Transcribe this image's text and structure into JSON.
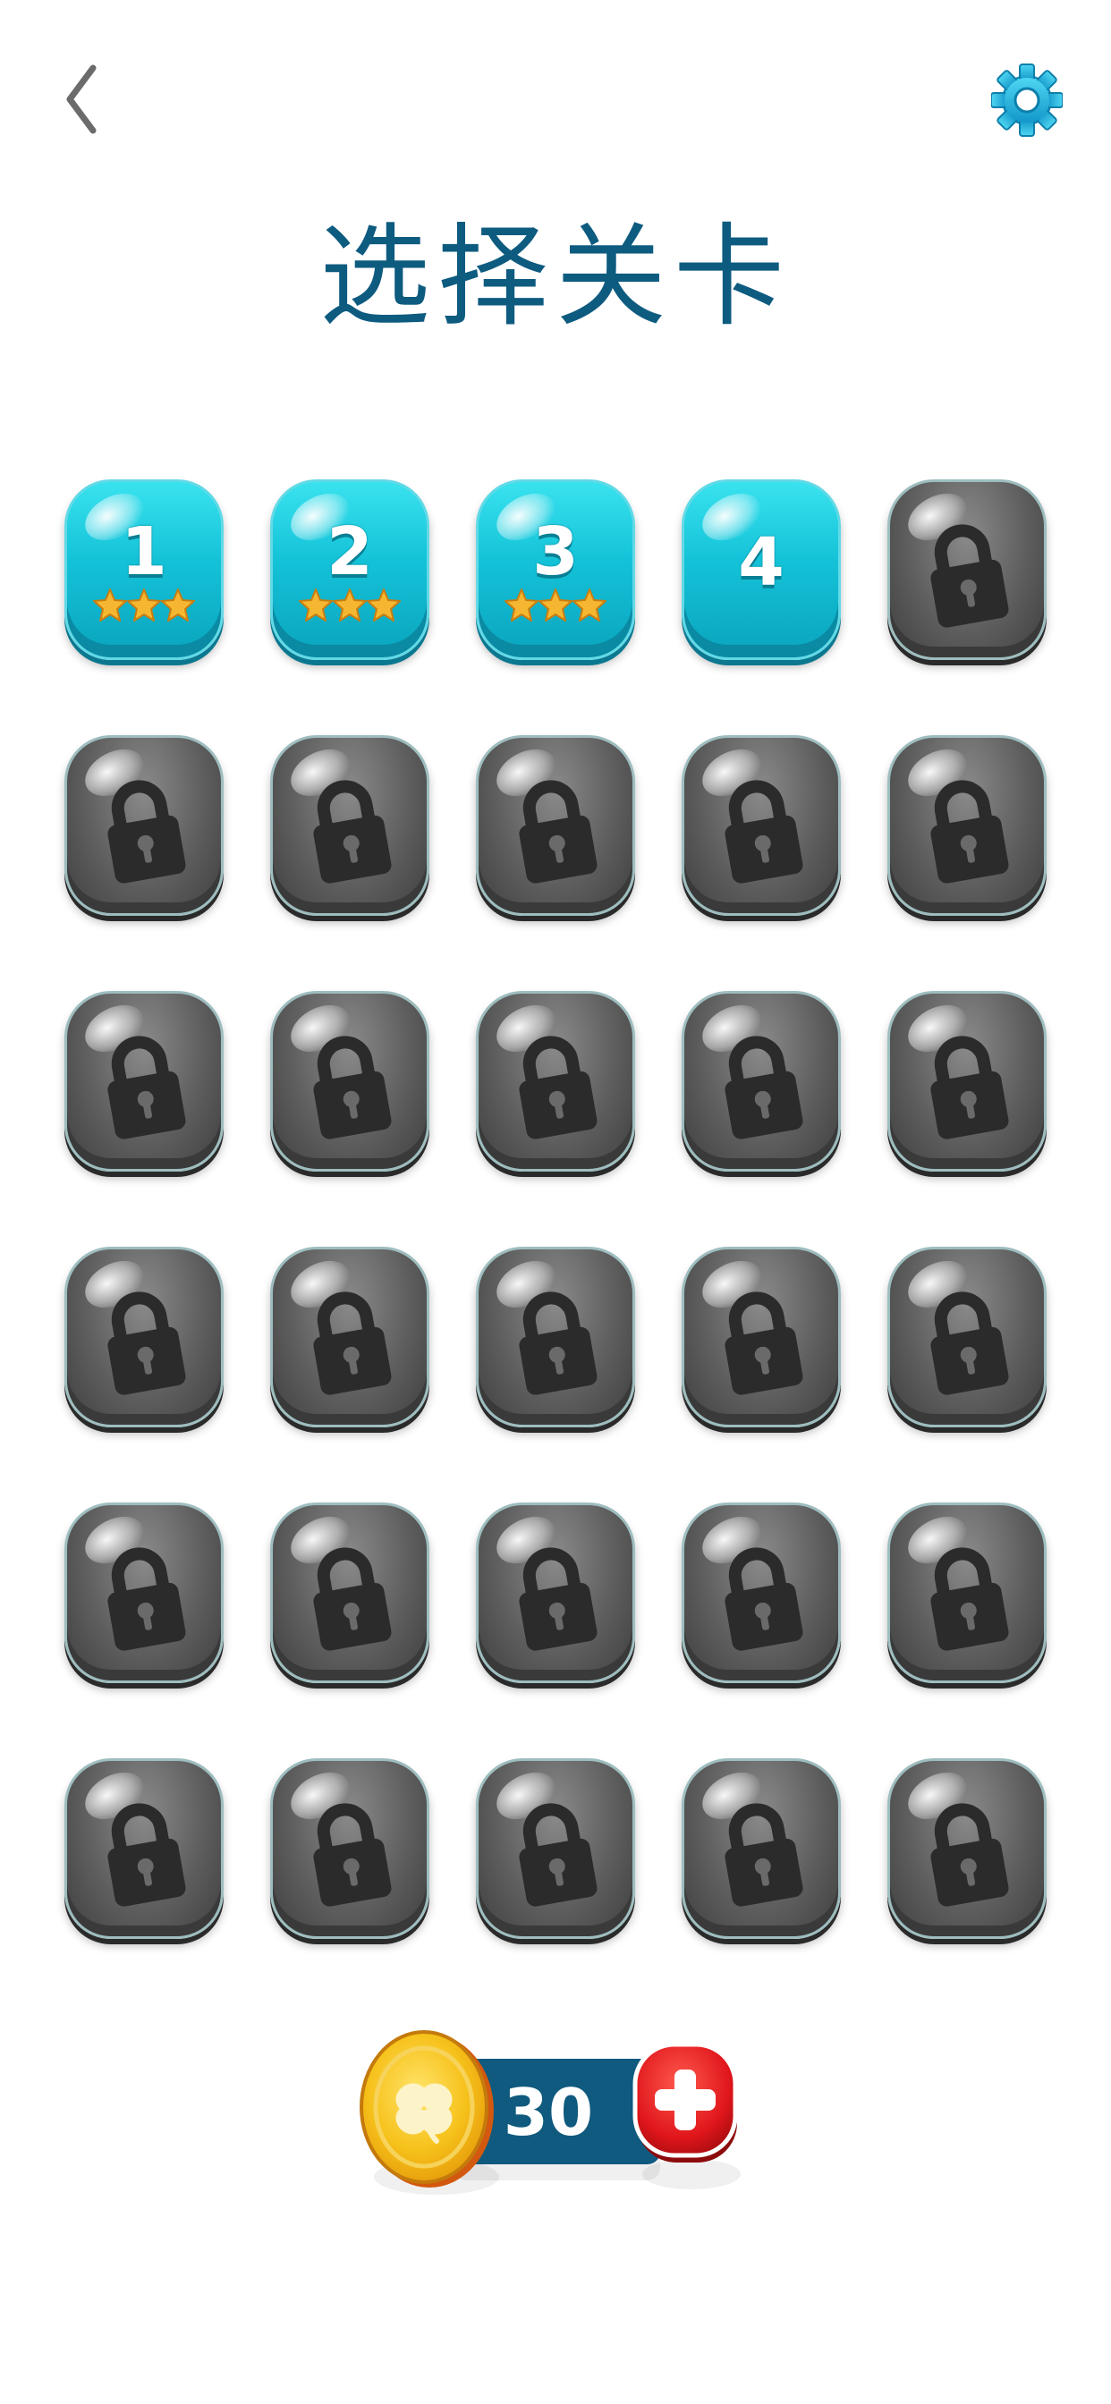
{
  "header": {
    "title": "选择关卡",
    "back_icon": "chevron-left-icon",
    "settings_icon": "gear-icon"
  },
  "levels": [
    {
      "label": "1",
      "locked": false,
      "stars": 3
    },
    {
      "label": "2",
      "locked": false,
      "stars": 3
    },
    {
      "label": "3",
      "locked": false,
      "stars": 3
    },
    {
      "label": "4",
      "locked": false,
      "stars": 0
    },
    {
      "label": "",
      "locked": true,
      "stars": 0
    },
    {
      "label": "",
      "locked": true,
      "stars": 0
    },
    {
      "label": "",
      "locked": true,
      "stars": 0
    },
    {
      "label": "",
      "locked": true,
      "stars": 0
    },
    {
      "label": "",
      "locked": true,
      "stars": 0
    },
    {
      "label": "",
      "locked": true,
      "stars": 0
    },
    {
      "label": "",
      "locked": true,
      "stars": 0
    },
    {
      "label": "",
      "locked": true,
      "stars": 0
    },
    {
      "label": "",
      "locked": true,
      "stars": 0
    },
    {
      "label": "",
      "locked": true,
      "stars": 0
    },
    {
      "label": "",
      "locked": true,
      "stars": 0
    },
    {
      "label": "",
      "locked": true,
      "stars": 0
    },
    {
      "label": "",
      "locked": true,
      "stars": 0
    },
    {
      "label": "",
      "locked": true,
      "stars": 0
    },
    {
      "label": "",
      "locked": true,
      "stars": 0
    },
    {
      "label": "",
      "locked": true,
      "stars": 0
    },
    {
      "label": "",
      "locked": true,
      "stars": 0
    },
    {
      "label": "",
      "locked": true,
      "stars": 0
    },
    {
      "label": "",
      "locked": true,
      "stars": 0
    },
    {
      "label": "",
      "locked": true,
      "stars": 0
    },
    {
      "label": "",
      "locked": true,
      "stars": 0
    },
    {
      "label": "",
      "locked": true,
      "stars": 0
    },
    {
      "label": "",
      "locked": true,
      "stars": 0
    },
    {
      "label": "",
      "locked": true,
      "stars": 0
    },
    {
      "label": "",
      "locked": true,
      "stars": 0
    },
    {
      "label": "",
      "locked": true,
      "stars": 0
    }
  ],
  "coins": {
    "value": "30",
    "coin_icon": "clover-coin-icon",
    "add_icon": "plus-icon"
  },
  "colors": {
    "title": "#0e5b80",
    "tile_unlocked": "#14c2d8",
    "tile_locked": "#5e5e5e",
    "star": "#f5b731",
    "coin_bar": "#0f5a7e",
    "add_button": "#e0161b",
    "coin": "#f2c012"
  }
}
